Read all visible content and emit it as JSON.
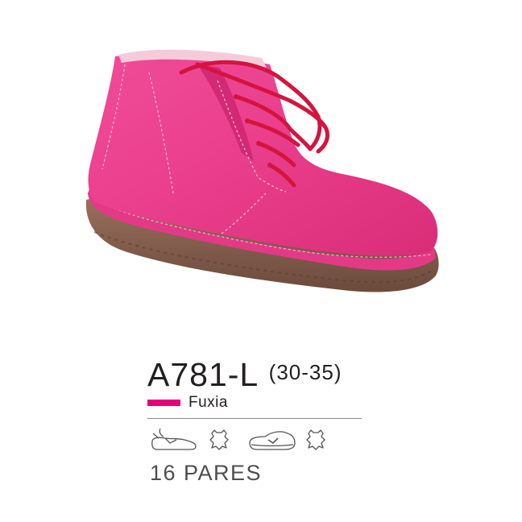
{
  "product": {
    "model_code": "A781-L",
    "size_range": "(30-35)",
    "color": {
      "name": "Fuxia",
      "swatch_hex": "#e3007b"
    },
    "pack_quantity": "16 PARES",
    "material_icons": [
      "upper-shoe-icon",
      "leather-icon",
      "sole-shoe-icon",
      "leather-icon"
    ]
  }
}
